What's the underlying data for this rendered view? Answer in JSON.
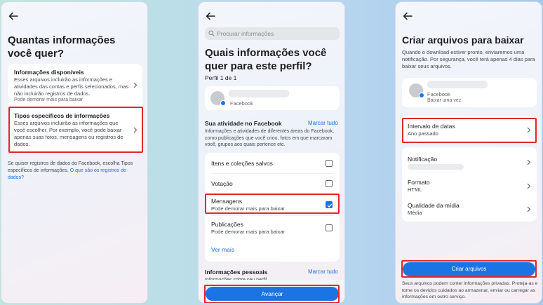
{
  "colors": {
    "accent": "#1b74e4",
    "highlight_border": "#e0262e",
    "card": "#ffffff"
  },
  "icons": [
    "back-arrow-icon",
    "search-icon",
    "chevron-right-icon",
    "checkbox-checked-icon",
    "facebook-badge-icon"
  ],
  "screen1": {
    "title": "Quantas informações você quer?",
    "options": [
      {
        "title": "Informações disponíveis",
        "desc": "Esses arquivos incluirão as informações e atividades das contas e perfis selecionados, mas não incluirão registros de dados.",
        "note": "Pode demorar mais para baixar"
      },
      {
        "title": "Tipos específicos de informações",
        "desc": "Esses arquivos incluirão as informações que você escolher. Por exemplo, você pode baixar apenas suas fotos, mensagens ou registros de dados."
      }
    ],
    "footer_text": "Se quiser registros de dados do Facebook, escolha Tipos específicos de informações.",
    "footer_link": "O que são os registros de dados?"
  },
  "screen2": {
    "search_placeholder": "Procurar informações",
    "title": "Quais informações você quer para este perfil?",
    "profile_count": "Perfil 1 de 1",
    "profile_platform": "Facebook",
    "section1": {
      "title": "Sua atividade no Facebook",
      "select_all": "Marcar tudo",
      "desc": "Informações e atividades de diferentes áreas do Facebook, como publicações que você criou, fotos em que marcaram você, grupos aos quais pertence etc.",
      "items": [
        {
          "label": "Itens e coleções salvos",
          "checked": false
        },
        {
          "label": "Votação",
          "checked": false
        },
        {
          "label": "Mensagens",
          "note": "Pode demorar mais para baixar",
          "checked": true
        },
        {
          "label": "Publicações",
          "note": "Pode demorar mais para baixar",
          "checked": false
        }
      ],
      "see_more": "Ver mais"
    },
    "section2": {
      "title": "Informações pessoais",
      "select_all": "Marcar tudo",
      "desc": "Informações sobre seu perfil"
    },
    "next_button": "Avançar"
  },
  "screen3": {
    "title": "Criar arquivos para baixar",
    "intro": "Quando o download estiver pronto, enviaremos uma notificação. Por segurança, você terá apenas 4 dias para baixar seus arquivos.",
    "profile_platform": "Facebook",
    "profile_frequency": "Baixar uma vez",
    "settings": [
      {
        "label": "Intervalo de datas",
        "value": "Ano passado"
      },
      {
        "label": "Notificação",
        "value": ""
      },
      {
        "label": "Formato",
        "value": "HTML"
      },
      {
        "label": "Qualidade da mídia",
        "value": "Média"
      }
    ],
    "create_button": "Criar arquivos",
    "privacy_note": "Seus arquivos podem conter informações privadas. Proteja-as e tome os devidos cuidados ao armazenar, enviar ou carregar as informações em outro serviço."
  }
}
